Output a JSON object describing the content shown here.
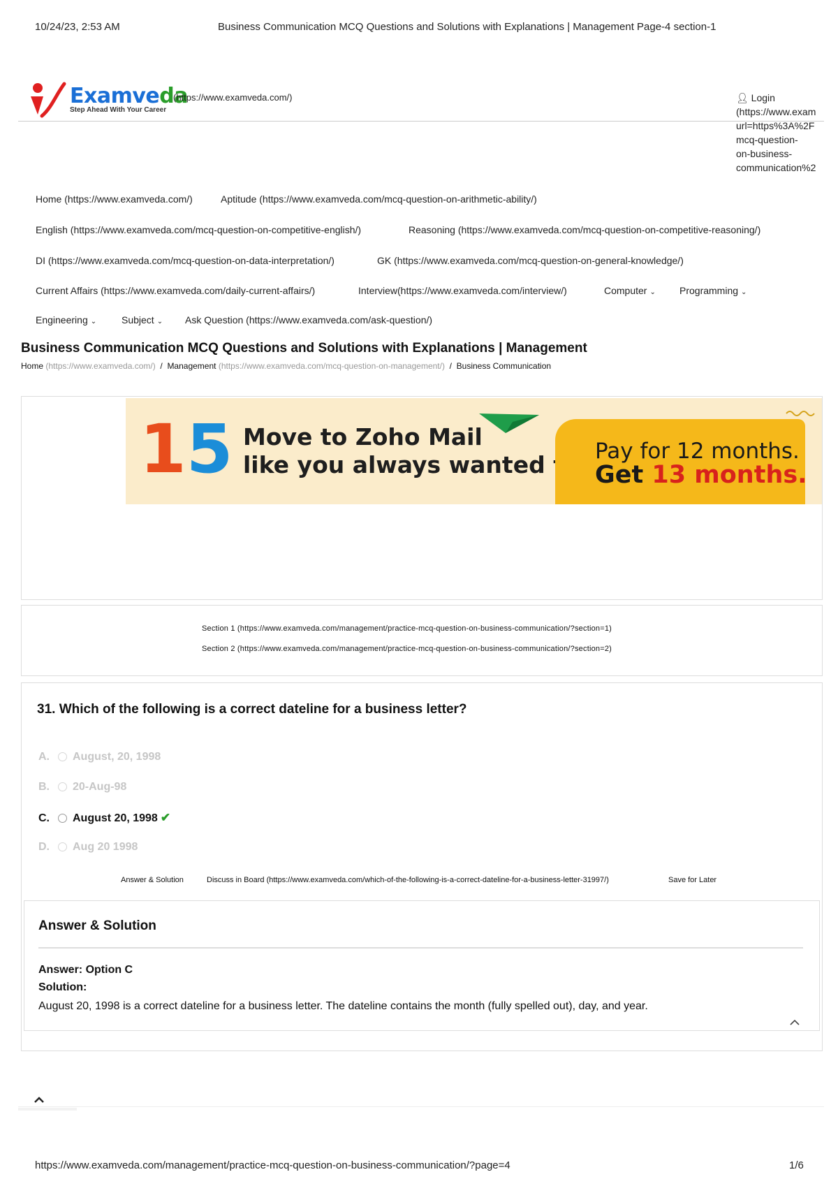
{
  "print_header": {
    "datetime": "10/24/23, 2:53 AM",
    "doc_title": "Business Communication MCQ Questions and Solutions with Explanations | Management Page-4 section-1"
  },
  "logo": {
    "wordmark_main": "Examve",
    "wordmark_end": "da",
    "tagline": "Step Ahead With Your Career",
    "link": "(https://www.examveda.com/)"
  },
  "login": {
    "label": "Login",
    "url_lines": [
      "(https://www.exam",
      "url=https%3A%2F",
      "mcq-question-",
      "on-business-",
      "communication%2"
    ]
  },
  "nav": {
    "row1": [
      "Home (https://www.examveda.com/)",
      "Aptitude (https://www.examveda.com/mcq-question-on-arithmetic-ability/)"
    ],
    "row2": [
      "English (https://www.examveda.com/mcq-question-on-competitive-english/)",
      "Reasoning (https://www.examveda.com/mcq-question-on-competitive-reasoning/)"
    ],
    "row3": [
      "DI (https://www.examveda.com/mcq-question-on-data-interpretation/)",
      "GK (https://www.examveda.com/mcq-question-on-general-knowledge/)"
    ],
    "row4": [
      "Current Affairs (https://www.examveda.com/daily-current-affairs/)",
      "Interview(https://www.examveda.com/interview/)",
      "Computer",
      "Programming"
    ],
    "row5": [
      "Engineering",
      "Subject",
      "Ask Question (https://www.examveda.com/ask-question/)"
    ]
  },
  "page_title": "Business Communication MCQ Questions and Solutions with Explanations | Management",
  "breadcrumb": {
    "home": "Home",
    "home_url": "(https://www.examveda.com/)",
    "sep": "/",
    "mgmt": "Management",
    "mgmt_url": "(https://www.examveda.com/mcq-question-on-management/)",
    "current": "Business Communication"
  },
  "ad": {
    "number_a": "1",
    "number_b": "5",
    "line1": "Move to Zoho Mail",
    "line2": "like you always wanted to",
    "right1": "Pay for 12 months.",
    "right2_a": "Get ",
    "right2_b": "13 months."
  },
  "sections": [
    "Section 1 (https://www.examveda.com/management/practice-mcq-question-on-business-communication/?section=1)",
    "Section 2 (https://www.examveda.com/management/practice-mcq-question-on-business-communication/?section=2)"
  ],
  "question": {
    "text": "31. Which of the following is a correct dateline for a business letter?",
    "options": [
      {
        "letter": "A.",
        "text": "August, 20, 1998"
      },
      {
        "letter": "B.",
        "text": "20-Aug-98"
      },
      {
        "letter": "C.",
        "text": "August 20, 1998"
      },
      {
        "letter": "D.",
        "text": "Aug 20 1998"
      }
    ],
    "correct_index": 2
  },
  "actions": {
    "answer": "Answer & Solution",
    "discuss": "Discuss in Board (https://www.examveda.com/which-of-the-following-is-a-correct-dateline-for-a-business-letter-31997/)",
    "save": "Save for Later"
  },
  "answer_panel": {
    "heading": "Answer & Solution",
    "answer_label": "Answer: Option C",
    "solution_label": "Solution:",
    "solution_text": "August 20, 1998 is a correct dateline for a business letter. The dateline contains the month (fully spelled out), day, and year."
  },
  "footer": {
    "url": "https://www.examveda.com/management/practice-mcq-question-on-business-communication/?page=4",
    "page": "1/6"
  },
  "colors": {
    "brand_blue": "#1a6fd6",
    "brand_green": "#2a9d2a",
    "logo_red": "#e02020",
    "correct_check": "#2a9d2a",
    "ad_yellow": "#f5b81a",
    "ad_red": "#d8221c"
  }
}
